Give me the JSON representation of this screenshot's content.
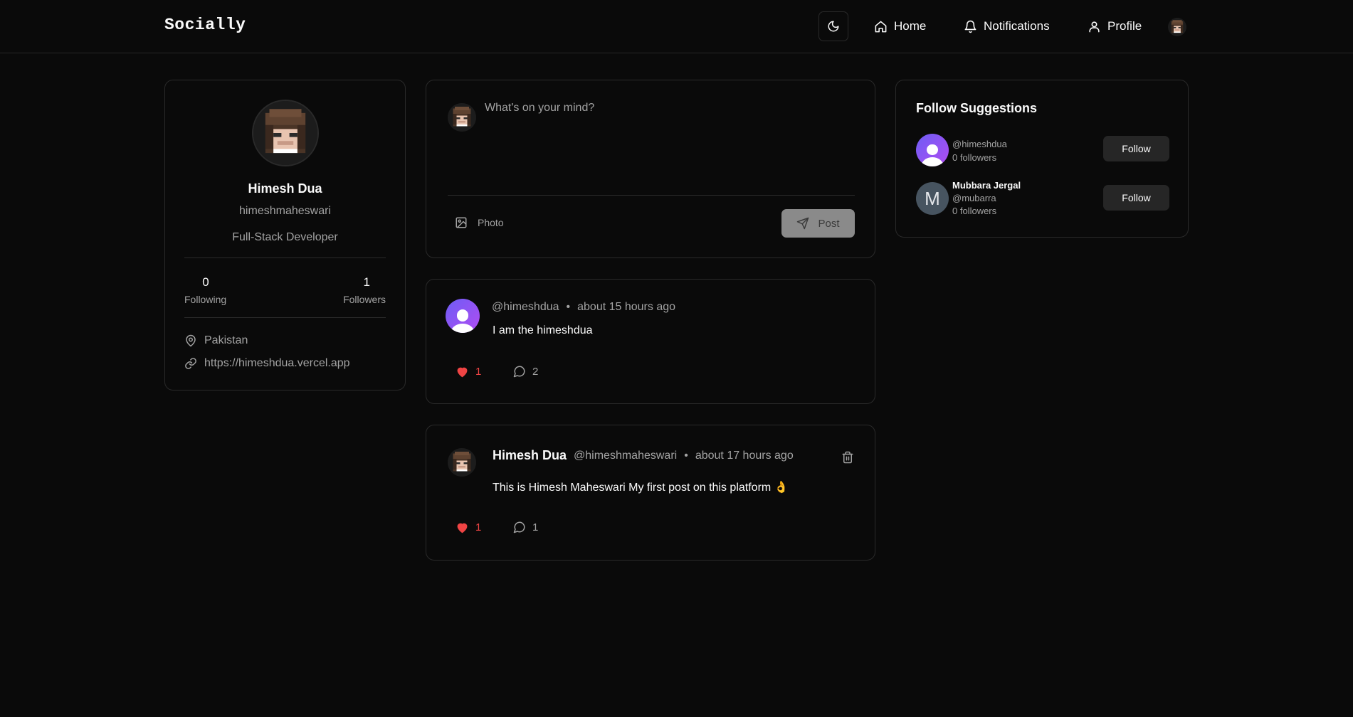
{
  "app": {
    "brand": "Socially"
  },
  "nav": {
    "home_label": "Home",
    "notifications_label": "Notifications",
    "profile_label": "Profile"
  },
  "profile_card": {
    "name": "Himesh Dua",
    "username": "himeshmaheswari",
    "bio": "Full-Stack Developer",
    "following_count": "0",
    "following_label": "Following",
    "followers_count": "1",
    "followers_label": "Followers",
    "location": "Pakistan",
    "website": "https://himeshdua.vercel.app"
  },
  "composer": {
    "placeholder": "What's on your mind?",
    "photo_label": "Photo",
    "post_label": "Post"
  },
  "posts": [
    {
      "author_name": "",
      "handle": "@himeshdua",
      "separator": "•",
      "time": "about 15 hours ago",
      "content": "I am the himeshdua",
      "likes": "1",
      "comments": "2"
    },
    {
      "author_name": "Himesh Dua",
      "handle": "@himeshmaheswari",
      "separator": "•",
      "time": "about 17 hours ago",
      "content": "This is Himesh Maheswari My first post on this platform 👌",
      "likes": "1",
      "comments": "1"
    }
  ],
  "suggestions": {
    "title": "Follow Suggestions",
    "items": [
      {
        "name": "",
        "handle": "@himeshdua",
        "followers": "0 followers",
        "button": "Follow"
      },
      {
        "name": "Mubbara Jergal",
        "handle": "@mubarra",
        "followers": "0 followers",
        "button": "Follow",
        "initial": "M"
      }
    ]
  },
  "colors": {
    "background": "#0a0a0a",
    "border": "#2a2a2a",
    "like": "#ef4444",
    "accent_gradient_start": "#6d5df5",
    "accent_gradient_end": "#b14cf2"
  }
}
